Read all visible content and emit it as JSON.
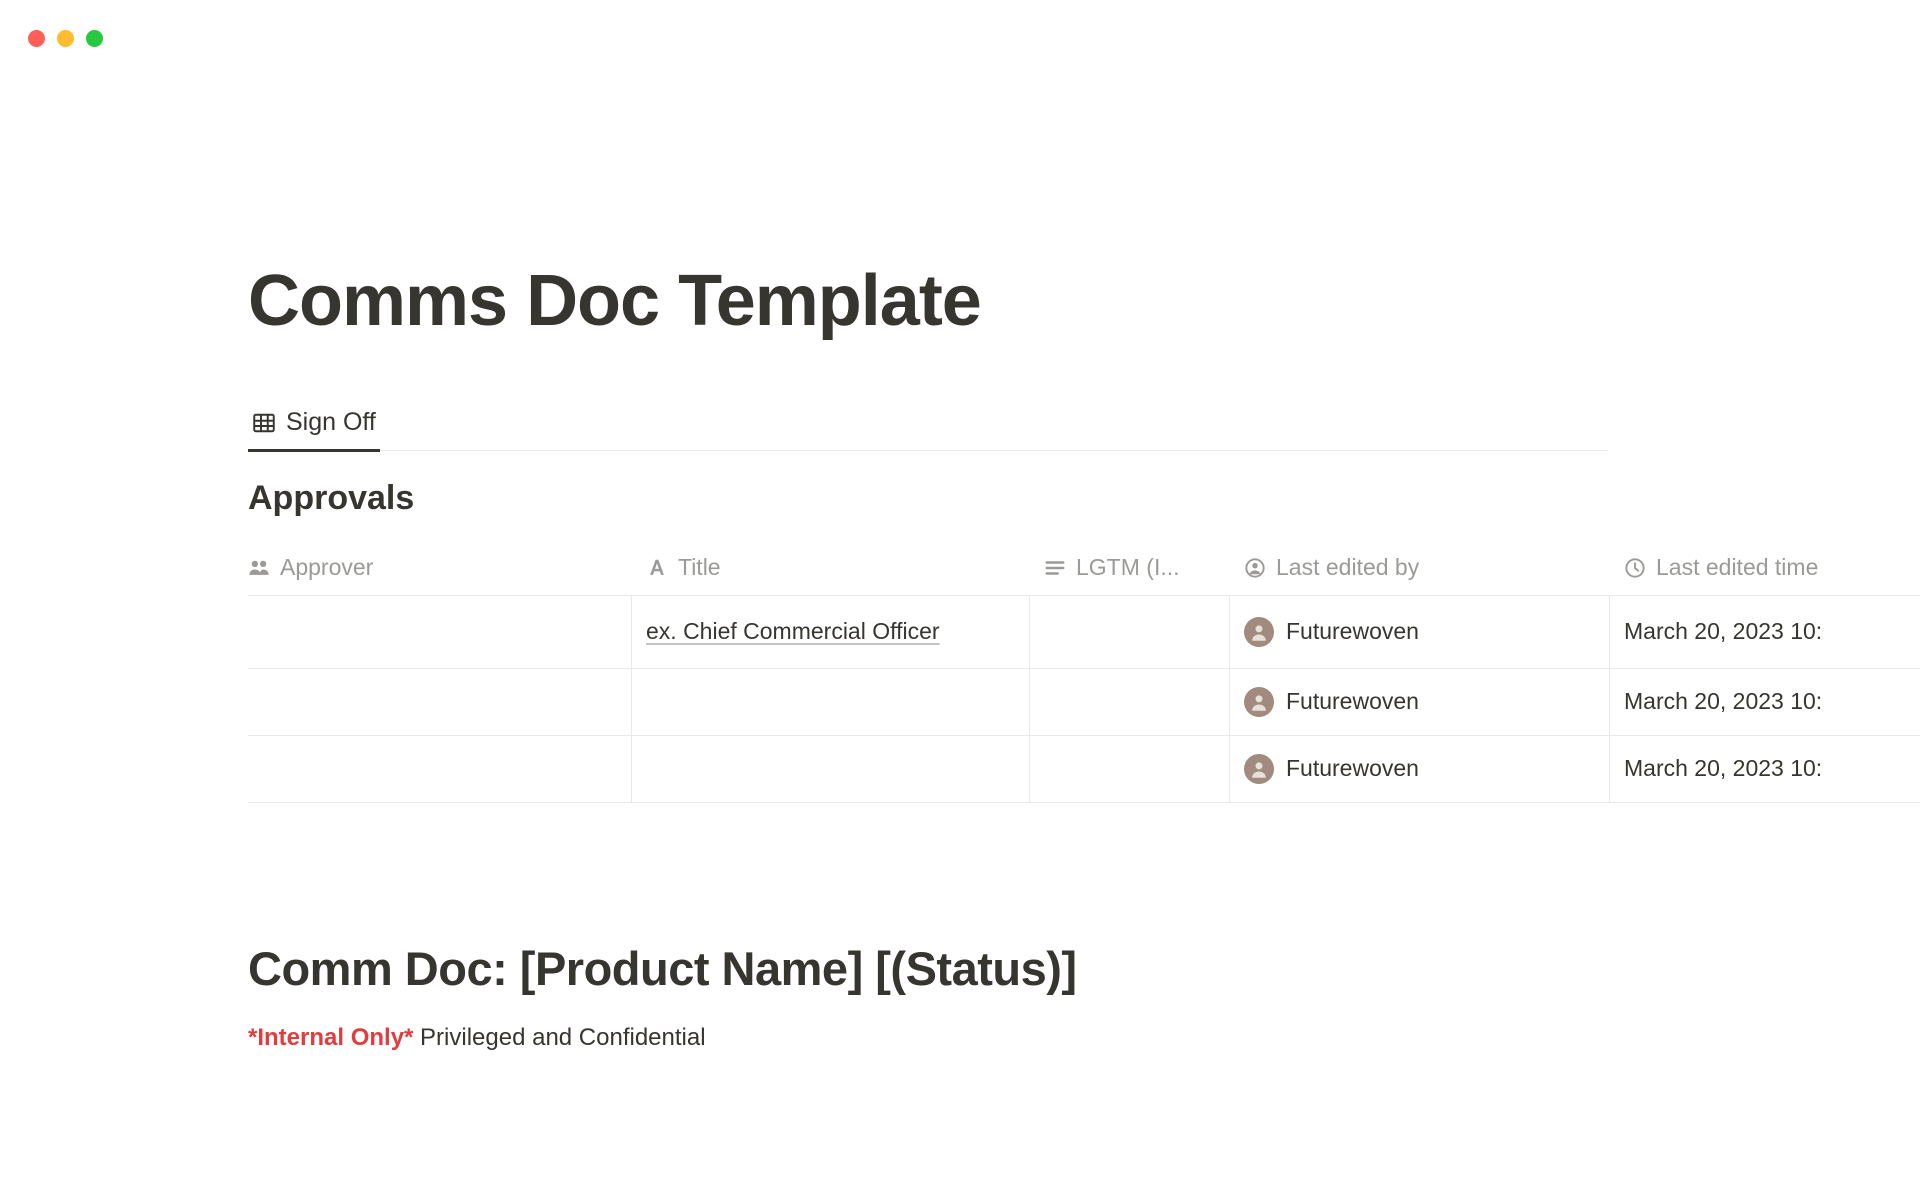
{
  "page": {
    "title": "Comms Doc Template",
    "tab_label": "Sign Off",
    "section_title": "Approvals"
  },
  "columns": {
    "approver": "Approver",
    "title": "Title",
    "lgtm": "LGTM (I...",
    "edited_by": "Last edited by",
    "edited_time": "Last edited time"
  },
  "rows": [
    {
      "approver": "",
      "title": "ex. Chief Commercial Officer",
      "lgtm": "",
      "edited_by": "Futurewoven",
      "edited_time": "March 20, 2023 10:"
    },
    {
      "approver": "",
      "title": "",
      "lgtm": "",
      "edited_by": "Futurewoven",
      "edited_time": "March 20, 2023 10:"
    },
    {
      "approver": "",
      "title": "",
      "lgtm": "",
      "edited_by": "Futurewoven",
      "edited_time": "March 20, 2023 10:"
    }
  ],
  "doc": {
    "heading": "Comm Doc: [Product Name] [(Status)]",
    "internal_label": "*Internal Only*",
    "classification_text": " Privileged and Confidential"
  }
}
